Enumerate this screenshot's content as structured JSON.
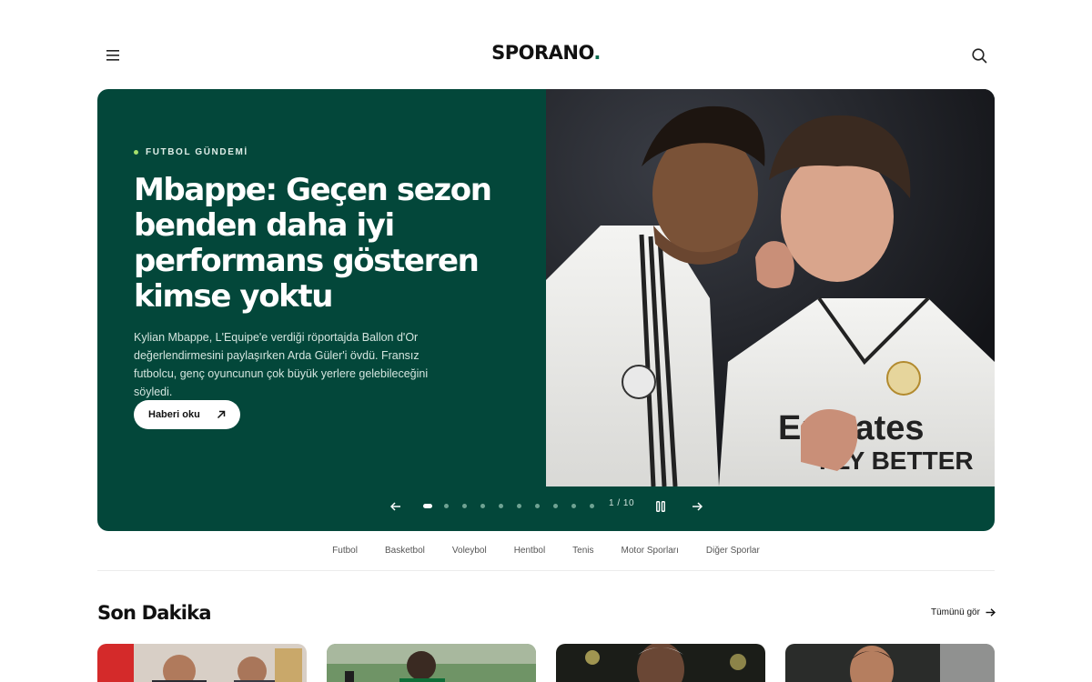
{
  "header": {
    "logo_text": "SPORANO",
    "logo_dot": ".",
    "menu_icon": "hamburger-menu-icon",
    "search_icon": "search-icon"
  },
  "hero": {
    "kicker": "FUTBOL GÜNDEMİ",
    "title": "Mbappe: Geçen sezon benden daha iyi performans gösteren kimse yoktu",
    "description": "Kylian Mbappe, L'Equipe'e verdiği röportajda Ballon d'Or değerlendirmesini paylaşırken Arda Güler'i övdü. Fransız futbolcu, genç oyuncunun çok büyük yerlere gelebileceğini söyledi.",
    "cta_label": "Haberi oku",
    "image_alt": "Two players in white Real Madrid kits talking",
    "counter": "1 / 10",
    "slide_count": 10,
    "active_slide": 1,
    "accent_color": "#03473a"
  },
  "categories": [
    "Futbol",
    "Basketbol",
    "Voleybol",
    "Hentbol",
    "Tenis",
    "Motor Sporları",
    "Diğer Sporlar"
  ],
  "section": {
    "title": "Son Dakika",
    "see_all": "Tümünü gör"
  },
  "cards": [
    {
      "image_alt": "Officials in front of Turkish flag"
    },
    {
      "image_alt": "Player in green kit on pitch"
    },
    {
      "image_alt": "Player close-up at night stadium"
    },
    {
      "image_alt": "Player close-up in stadium"
    }
  ]
}
